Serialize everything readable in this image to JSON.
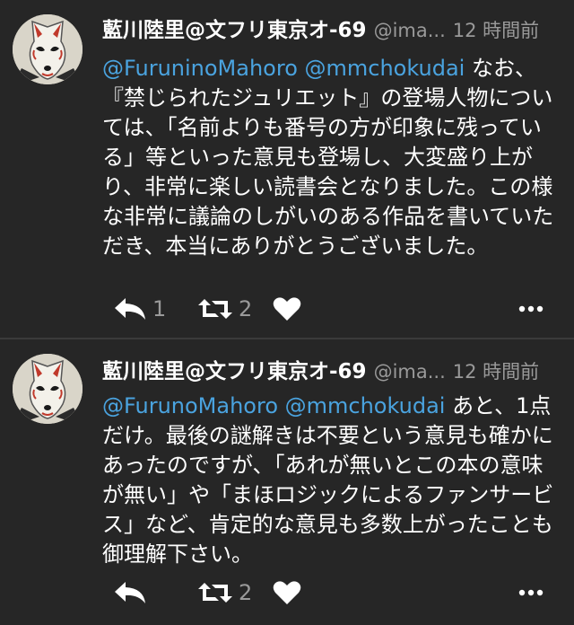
{
  "tweets": [
    {
      "display_name": "藍川陸里@文フリ東京オ-69",
      "handle": "@ima...",
      "time": "12 時間前",
      "mentions": "@FuruninoMahoro @mmchokudai",
      "text": " なお、『禁じられたジュリエット』の登場人物については、「名前よりも番号の方が印象に残っている」等といった意見も登場し、大変盛り上がり、非常に楽しい読書会となりました。この様な非常に議論のしがいのある作品を書いていただき、本当にありがとうございました。",
      "reply_count": "1",
      "retweet_count": "2"
    },
    {
      "display_name": "藍川陸里@文フリ東京オ-69",
      "handle": "@ima...",
      "time": "12 時間前",
      "mentions": "@FurunoMahoro @mmchokudai",
      "text": " あと、1点だけ。最後の謎解きは不要という意見も確かにあったのですが、「あれが無いとこの本の意味が無い」や「まほロジックによるファンサービス」など、肯定的な意見も多数上がったことも御理解下さい。",
      "retweet_count": "2"
    }
  ],
  "icons": {
    "reply": "reply-icon",
    "retweet": "retweet-icon",
    "like": "heart-icon",
    "more": "more-icon"
  }
}
